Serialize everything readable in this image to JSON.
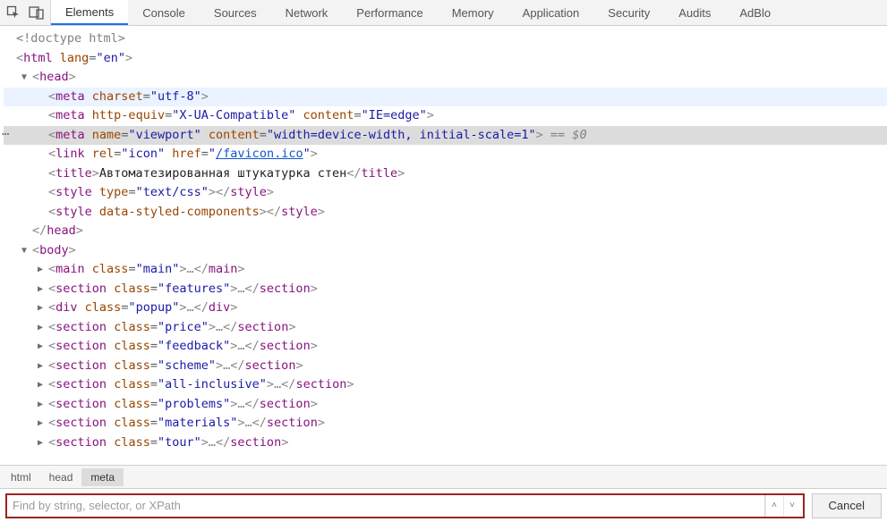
{
  "tabs": {
    "elements": "Elements",
    "console": "Console",
    "sources": "Sources",
    "network": "Network",
    "performance": "Performance",
    "memory": "Memory",
    "application": "Application",
    "security": "Security",
    "audits": "Audits",
    "adblock": "AdBlo"
  },
  "dom": {
    "doctype": "<!doctype html>",
    "html_open_1": "<",
    "html_tag": "html",
    "html_attr_lang": "lang",
    "html_val_lang": "\"en\"",
    "html_open_2": ">",
    "head_open_1": "<",
    "head_tag": "head",
    "head_open_2": ">",
    "meta_charset_1": "<",
    "meta_charset_tag": "meta",
    "meta_charset_attr": "charset",
    "meta_charset_val": "\"utf-8\"",
    "meta_charset_2": ">",
    "meta_xua_1": "<",
    "meta_xua_tag": "meta",
    "meta_xua_attr1": "http-equiv",
    "meta_xua_val1": "\"X-UA-Compatible\"",
    "meta_xua_attr2": "content",
    "meta_xua_val2": "\"IE=edge\"",
    "meta_xua_2": ">",
    "meta_vp_1": "<",
    "meta_vp_tag": "meta",
    "meta_vp_attr1": "name",
    "meta_vp_val1": "\"viewport\"",
    "meta_vp_attr2": "content",
    "meta_vp_val2": "\"width=device-width, initial-scale=1\"",
    "meta_vp_2": ">",
    "meta_vp_eq": " == ",
    "meta_vp_so": "$0",
    "link_1": "<",
    "link_tag": "link",
    "link_attr1": "rel",
    "link_val1": "\"icon\"",
    "link_attr2": "href",
    "link_val2_q": "\"",
    "link_val2": "/favicon.ico",
    "link_2": ">",
    "title_1": "<",
    "title_tag": "title",
    "title_2": ">",
    "title_text": "Автоматезированная штукатурка стен",
    "title_3": "</",
    "title_4": ">",
    "style1_1": "<",
    "style1_tag": "style",
    "style1_attr": "type",
    "style1_val": "\"text/css\"",
    "style1_2": ">",
    "style1_3": "</",
    "style1_4": ">",
    "style2_1": "<",
    "style2_tag": "style",
    "style2_attr": "data-styled-components",
    "style2_2": ">",
    "style2_3": "</",
    "style2_4": ">",
    "head_close_1": "</",
    "head_close_2": ">",
    "body_open_1": "<",
    "body_tag": "body",
    "body_open_2": ">",
    "main_1": "<",
    "main_tag": "main",
    "main_attr": "class",
    "main_val": "\"main\"",
    "main_2": ">",
    "main_dots": "…",
    "main_3": "</",
    "main_4": ">",
    "feat_1": "<",
    "feat_tag": "section",
    "feat_attr": "class",
    "feat_val": "\"features\"",
    "feat_2": ">",
    "feat_dots": "…",
    "feat_3": "</",
    "feat_4": ">",
    "popup_1": "<",
    "popup_tag": "div",
    "popup_attr": "class",
    "popup_val": "\"popup\"",
    "popup_2": ">",
    "popup_dots": "…",
    "popup_3": "</",
    "popup_4": ">",
    "price_1": "<",
    "price_tag": "section",
    "price_attr": "class",
    "price_val": "\"price\"",
    "price_2": ">",
    "price_dots": "…",
    "price_3": "</",
    "price_4": ">",
    "fb_1": "<",
    "fb_tag": "section",
    "fb_attr": "class",
    "fb_val": "\"feedback\"",
    "fb_2": ">",
    "fb_dots": "…",
    "fb_3": "</",
    "fb_4": ">",
    "sch_1": "<",
    "sch_tag": "section",
    "sch_attr": "class",
    "sch_val": "\"scheme\"",
    "sch_2": ">",
    "sch_dots": "…",
    "sch_3": "</",
    "sch_4": ">",
    "ai_1": "<",
    "ai_tag": "section",
    "ai_attr": "class",
    "ai_val": "\"all-inclusive\"",
    "ai_2": ">",
    "ai_dots": "…",
    "ai_3": "</",
    "ai_4": ">",
    "pr_1": "<",
    "pr_tag": "section",
    "pr_attr": "class",
    "pr_val": "\"problems\"",
    "pr_2": ">",
    "pr_dots": "…",
    "pr_3": "</",
    "pr_4": ">",
    "mat_1": "<",
    "mat_tag": "section",
    "mat_attr": "class",
    "mat_val": "\"materials\"",
    "mat_2": ">",
    "mat_dots": "…",
    "mat_3": "</",
    "mat_4": ">",
    "tour_1": "<",
    "tour_tag": "section",
    "tour_attr": "class",
    "tour_val": "\"tour\"",
    "tour_2": ">",
    "tour_dots": "…",
    "tour_3": "</",
    "tour_4": ">"
  },
  "breadcrumb": {
    "html": "html",
    "head": "head",
    "meta": "meta"
  },
  "search": {
    "placeholder": "Find by string, selector, or XPath",
    "cancel": "Cancel"
  }
}
